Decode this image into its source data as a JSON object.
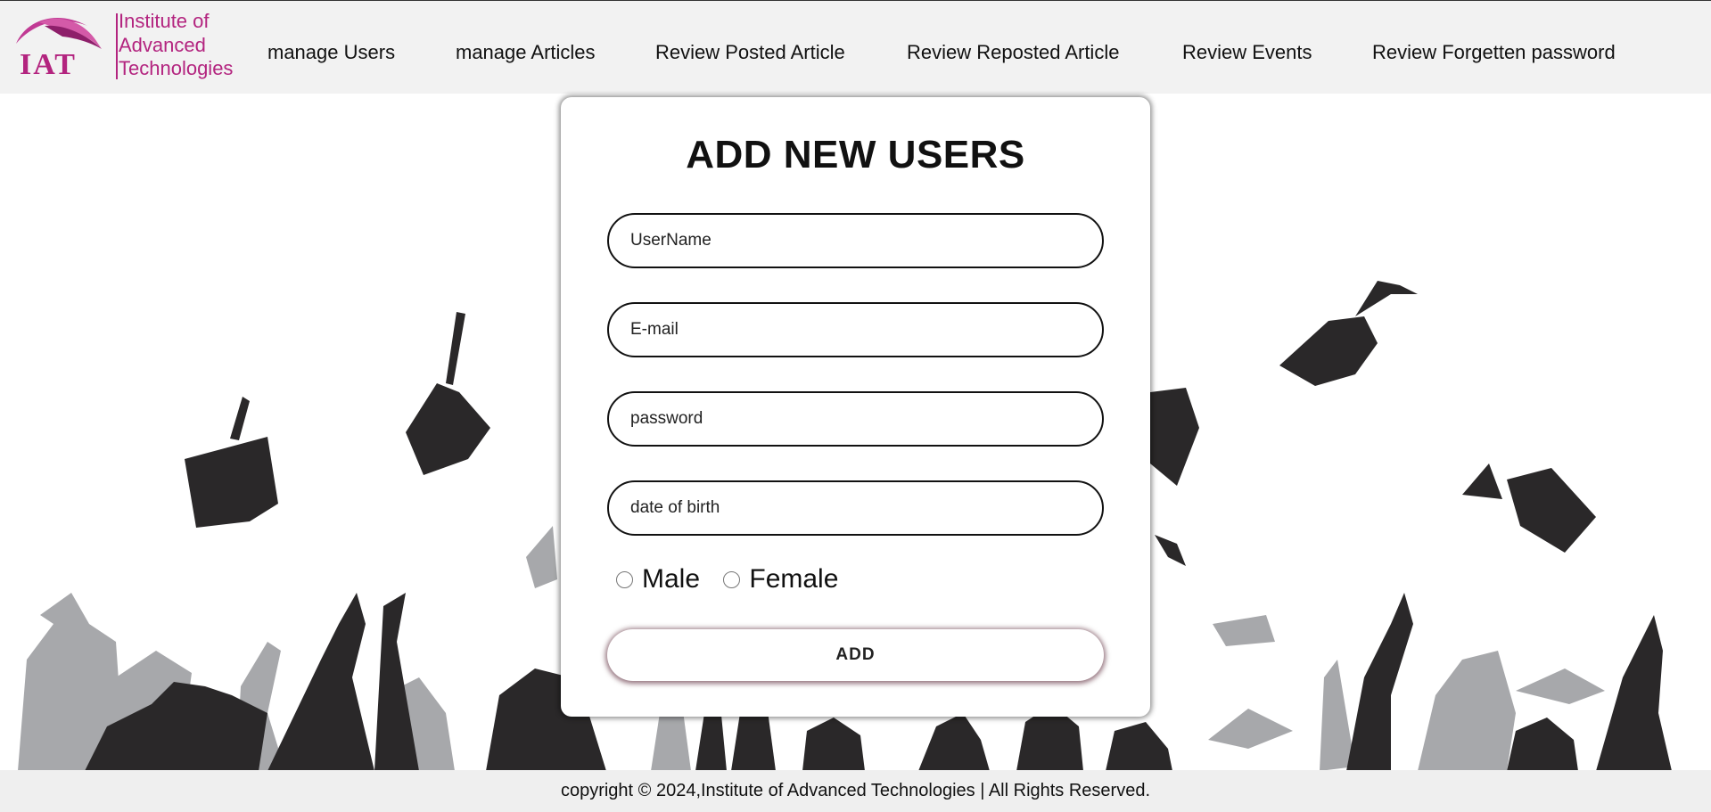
{
  "header": {
    "logo": {
      "mark_text": "IAT",
      "lines": [
        "Institute of",
        "Advanced",
        "Technologies"
      ]
    },
    "nav": [
      {
        "label": "manage Users"
      },
      {
        "label": "manage Articles"
      },
      {
        "label": "Review Posted Article"
      },
      {
        "label": "Review Reposted Article"
      },
      {
        "label": "Review Events"
      },
      {
        "label": "Review Forgetten password"
      }
    ]
  },
  "form": {
    "title": "ADD NEW USERS",
    "fields": [
      {
        "placeholder": "UserName"
      },
      {
        "placeholder": "E-mail"
      },
      {
        "placeholder": "password"
      },
      {
        "placeholder": "date of birth"
      }
    ],
    "gender_options": [
      "Male",
      "Female"
    ],
    "submit_label": "ADD"
  },
  "footer": {
    "text": "copyright © 2024,Institute of Advanced Technologies | All Rights Reserved."
  },
  "colors": {
    "brand": "#b3247f",
    "silhouette_dark": "#2a2829",
    "silhouette_light": "#a7a8ab"
  },
  "icons": {
    "logo": "iat-arch-logo",
    "background": "graduation-cap-toss-silhouette"
  }
}
